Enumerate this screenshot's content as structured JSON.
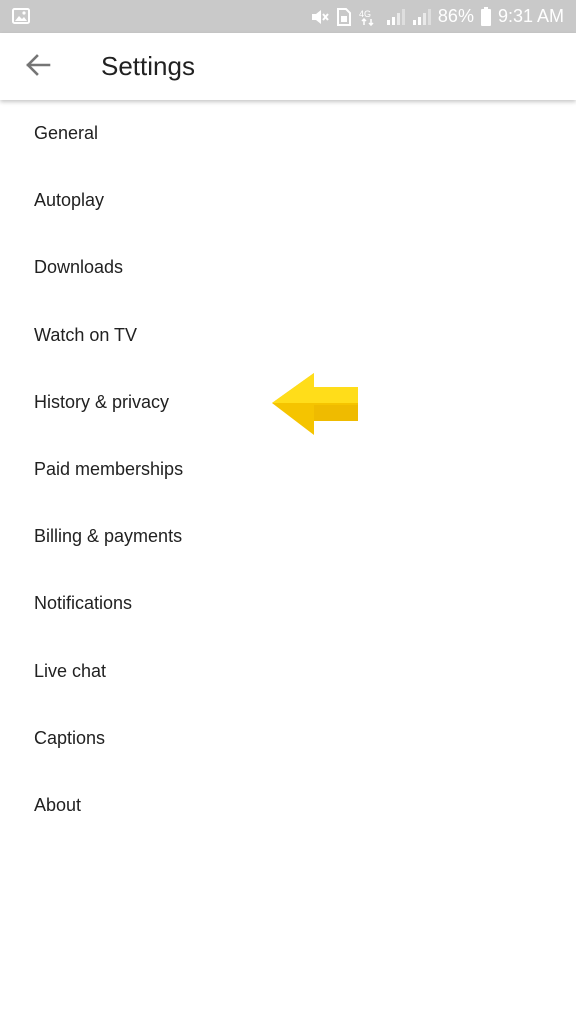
{
  "status_bar": {
    "battery_percent": "86%",
    "time": "9:31 AM",
    "network": "4G"
  },
  "header": {
    "title": "Settings"
  },
  "settings_items": [
    {
      "label": "General"
    },
    {
      "label": "Autoplay"
    },
    {
      "label": "Downloads"
    },
    {
      "label": "Watch on TV"
    },
    {
      "label": "History & privacy"
    },
    {
      "label": "Paid memberships"
    },
    {
      "label": "Billing & payments"
    },
    {
      "label": "Notifications"
    },
    {
      "label": "Live chat"
    },
    {
      "label": "Captions"
    },
    {
      "label": "About"
    }
  ],
  "annotation": {
    "arrow_color": "#f5c400",
    "arrow_icon": "left-arrow-icon"
  }
}
